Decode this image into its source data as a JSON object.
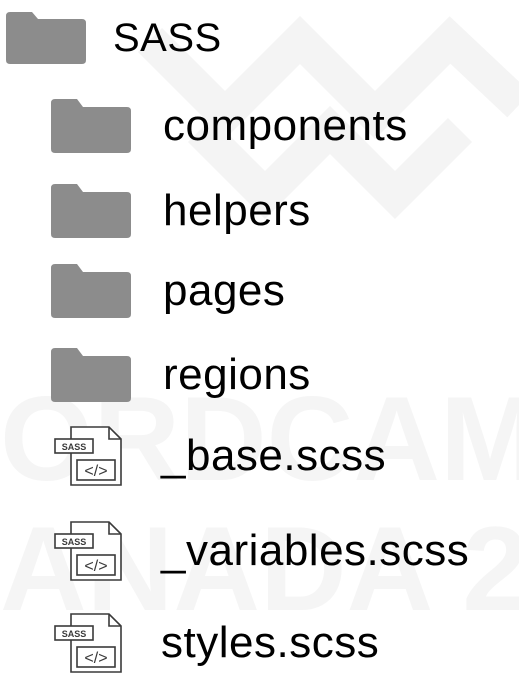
{
  "tree": {
    "root": {
      "label": "SASS",
      "icon": "folder-icon"
    },
    "children": [
      {
        "label": "components",
        "icon": "folder-icon"
      },
      {
        "label": "helpers",
        "icon": "folder-icon"
      },
      {
        "label": "pages",
        "icon": "folder-icon"
      },
      {
        "label": "regions",
        "icon": "folder-icon"
      },
      {
        "label": "_base.scss",
        "icon": "sass-file-icon",
        "badge": "SASS"
      },
      {
        "label": "_variables.scss",
        "icon": "sass-file-icon",
        "badge": "SASS"
      },
      {
        "label": "styles.scss",
        "icon": "sass-file-icon",
        "badge": "SASS"
      }
    ]
  },
  "colors": {
    "folder": "#8c8c8c",
    "text": "#000000",
    "file_outline": "#3a3a3a",
    "watermark": "#f3f3f3"
  }
}
